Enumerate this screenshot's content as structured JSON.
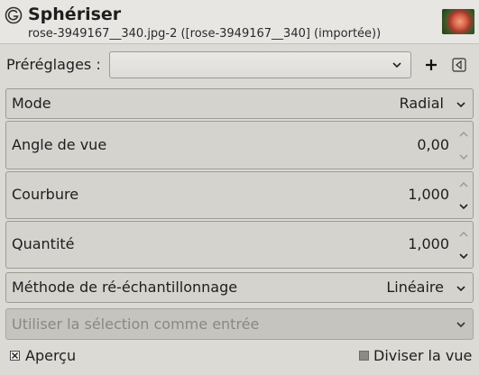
{
  "dialog": {
    "title": "Sphériser",
    "subtitle": "rose-3949167__340.jpg-2 ([rose-3949167__340] (importée))"
  },
  "presets": {
    "label": "Préréglages :",
    "value": ""
  },
  "mode": {
    "label": "Mode",
    "value": "Radial"
  },
  "angle": {
    "label": "Angle de vue",
    "value": "0,00"
  },
  "curvature": {
    "label": "Courbure",
    "value": "1,000"
  },
  "amount": {
    "label": "Quantité",
    "value": "1,000"
  },
  "resampling": {
    "label": "Méthode de ré-échantillonnage",
    "value": "Linéaire"
  },
  "selection_input": {
    "label": "Utiliser la sélection comme entrée"
  },
  "preview": {
    "label": "Aperçu",
    "checked": true
  },
  "split_view": {
    "label": "Diviser la vue",
    "checked": false
  },
  "icons": [
    "gimp-wilber-icon",
    "image-thumbnail",
    "chevron-down-icon",
    "add-icon",
    "menu-icon",
    "spin-up-icon",
    "spin-down-icon"
  ]
}
